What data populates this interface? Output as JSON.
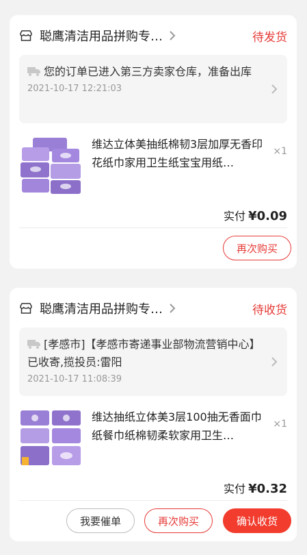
{
  "orders": [
    {
      "shop_name": "聪鹰清洁用品拼购专…",
      "status": "待发货",
      "logistics_text": "您的订单已进入第三方卖家仓库，准备出库",
      "logistics_time": "2021-10-17 12:21:03",
      "product_title": "维达立体美抽纸棉韧3层加厚无香印花纸巾家用卫生纸宝宝用纸…",
      "quantity": "×1",
      "paid_label": "实付",
      "paid_amount": "¥0.09",
      "buttons": {
        "rebuy": "再次购买"
      }
    },
    {
      "shop_name": "聪鹰清洁用品拼购专…",
      "status": "待收货",
      "logistics_text": "[孝感市]【孝感市寄递事业部物流营销中心】已收寄,揽投员:雷阳",
      "logistics_time": "2021-10-17 11:08:39",
      "product_title": "维达抽纸立体美3层100抽无香面巾纸餐巾纸棉韧柔软家用卫生…",
      "quantity": "×1",
      "paid_label": "实付",
      "paid_amount": "¥0.32",
      "buttons": {
        "urge": "我要催单",
        "rebuy": "再次购买",
        "confirm": "确认收货"
      }
    }
  ],
  "colors": {
    "accent": "#e53935",
    "button_solid": "#f23c2e",
    "product_purple": "#8b6fc9"
  },
  "icons": [
    "store-icon",
    "chevron-right-icon",
    "truck-icon",
    "product-image"
  ]
}
